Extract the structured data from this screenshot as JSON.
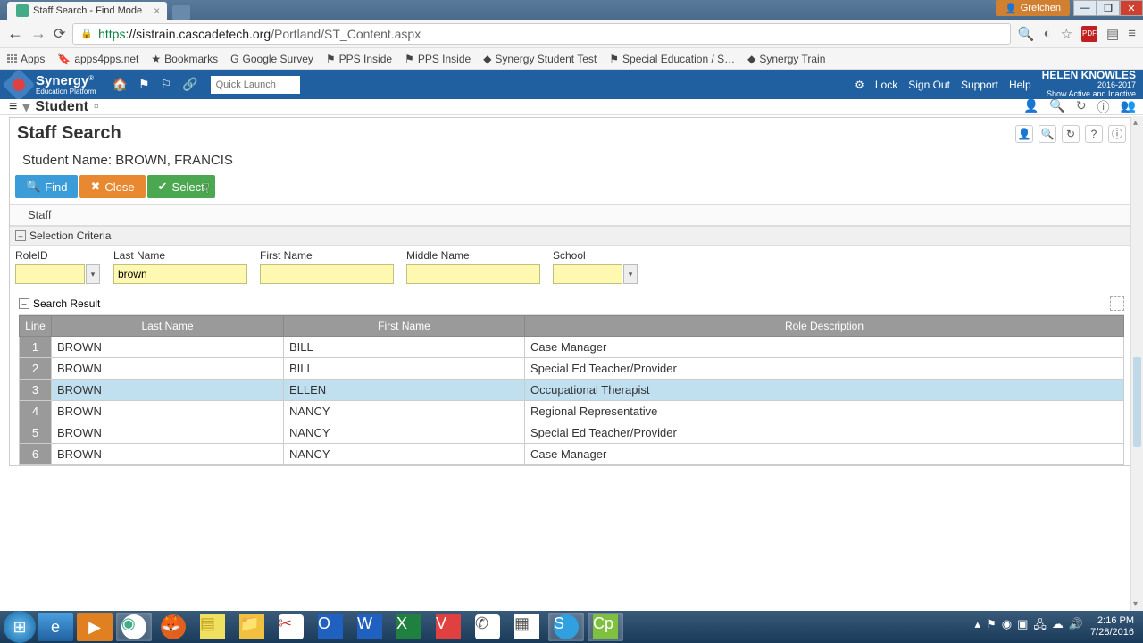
{
  "browser": {
    "tab_title": "Staff Search - Find Mode",
    "win_user": "Gretchen",
    "url_https": "https",
    "url_domain": "://sistrain.cascadetech.org",
    "url_path": "/Portland/ST_Content.aspx"
  },
  "bookmarks": {
    "apps": "Apps",
    "items": [
      "apps4pps.net",
      "Bookmarks",
      "Google Survey",
      "PPS Inside",
      "PPS Inside",
      "Synergy Student Test",
      "Special Education / S…",
      "Synergy Train"
    ]
  },
  "header": {
    "brand": "Synergy",
    "brand_sub": "Education Platform",
    "quick_launch_placeholder": "Quick Launch",
    "links": {
      "lock": "Lock",
      "signout": "Sign Out",
      "support": "Support",
      "help": "Help"
    },
    "user": {
      "name": "HELEN KNOWLES",
      "year": "2016-2017",
      "note": "Show Active and Inactive"
    }
  },
  "breadcrumb": {
    "student": "Student"
  },
  "page": {
    "title": "Staff Search",
    "student_label": "Student Name:",
    "student_value": "BROWN, FRANCIS",
    "buttons": {
      "find": "Find",
      "close": "Close",
      "select": "Select"
    },
    "tab": "Staff"
  },
  "criteria": {
    "section_label": "Selection Criteria",
    "fields": {
      "roleid_label": "RoleID",
      "roleid_value": "",
      "last_label": "Last Name",
      "last_value": "brown",
      "first_label": "First Name",
      "first_value": "",
      "middle_label": "Middle Name",
      "middle_value": "",
      "school_label": "School",
      "school_value": ""
    }
  },
  "results": {
    "section_label": "Search Result",
    "columns": {
      "line": "Line",
      "last": "Last Name",
      "first": "First Name",
      "role": "Role Description"
    },
    "rows": [
      {
        "n": "1",
        "last": "BROWN",
        "first": "BILL",
        "role": "Case Manager"
      },
      {
        "n": "2",
        "last": "BROWN",
        "first": "BILL",
        "role": "Special Ed Teacher/Provider"
      },
      {
        "n": "3",
        "last": "BROWN",
        "first": "ELLEN",
        "role": "Occupational Therapist"
      },
      {
        "n": "4",
        "last": "BROWN",
        "first": "NANCY",
        "role": "Regional Representative"
      },
      {
        "n": "5",
        "last": "BROWN",
        "first": "NANCY",
        "role": "Special Ed Teacher/Provider"
      },
      {
        "n": "6",
        "last": "BROWN",
        "first": "NANCY",
        "role": "Case Manager"
      }
    ],
    "selected_index": 2
  },
  "taskbar": {
    "time": "2:16 PM",
    "date": "7/28/2016"
  }
}
